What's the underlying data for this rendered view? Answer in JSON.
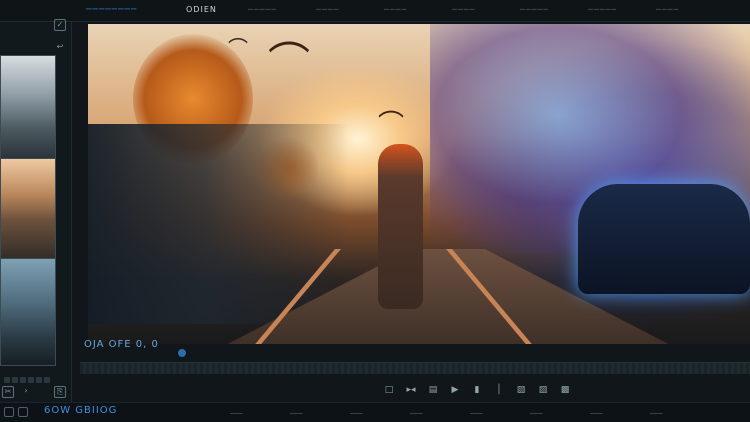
{
  "app": {
    "name": "────────"
  },
  "menu": [
    "ODIEN",
    "─────",
    "────",
    "────",
    "────",
    "─────",
    "─────",
    "────"
  ],
  "player": {
    "timecode": "OJA OFE 0,  0"
  },
  "controls": [
    "□",
    "▸◂",
    "▤",
    "▶",
    "▮",
    "│",
    "▧",
    "▨",
    "▩"
  ],
  "timeline": {
    "title": "6OW GBIIOG",
    "marks": [
      "───",
      "───",
      "───",
      "───",
      "───",
      "───",
      "───",
      "───"
    ]
  },
  "colors": {
    "accent": "#2c7fd6",
    "timecode": "#6aa3d9"
  }
}
